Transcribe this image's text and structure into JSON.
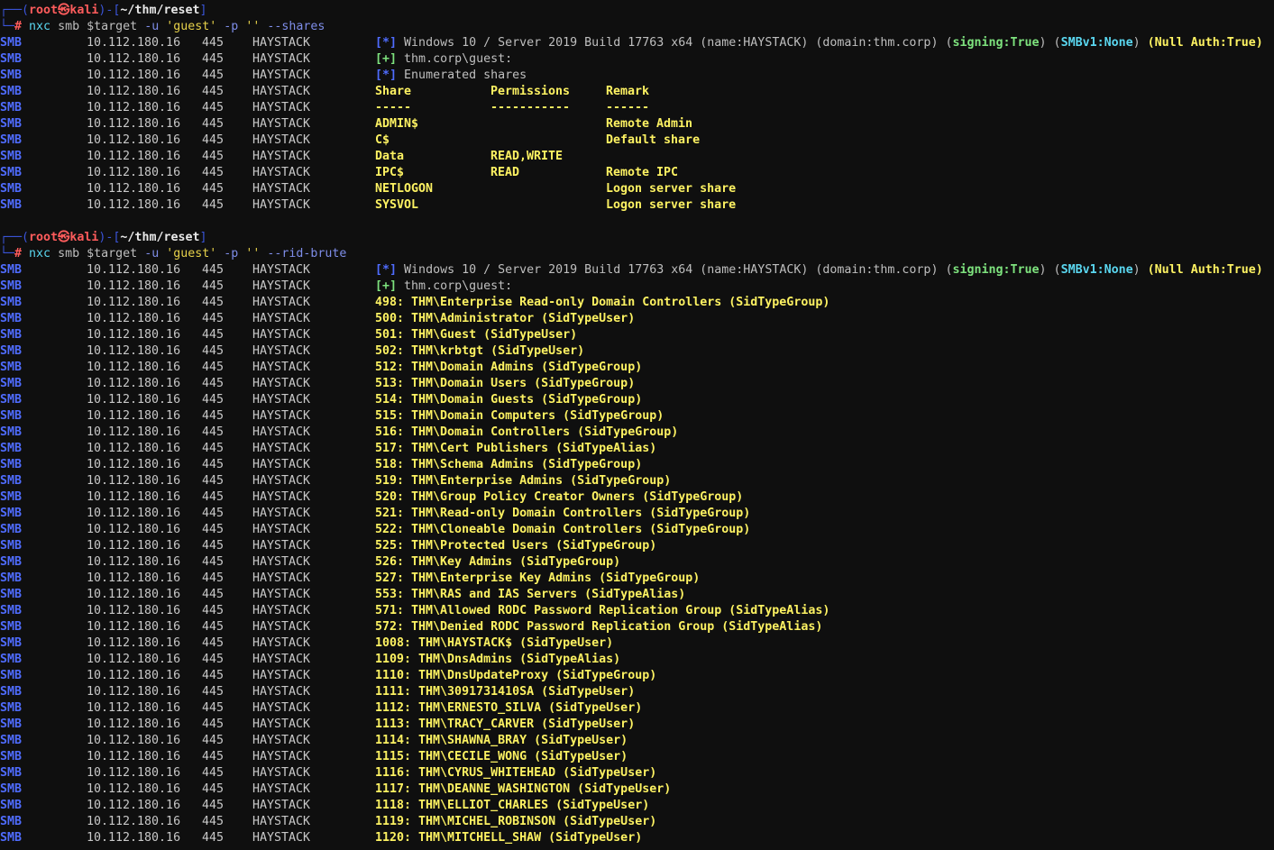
{
  "prompt": {
    "user": "root",
    "skull": "㉿",
    "host": "kali",
    "path": "~/thm/reset",
    "hash": "#"
  },
  "commands": [
    {
      "bin": "nxc",
      "sub": "smb",
      "target": "$target",
      "uflag": "-u",
      "uval": "'guest'",
      "pflag": "-p",
      "pval": "''",
      "opt": "--shares"
    },
    {
      "bin": "nxc",
      "sub": "smb",
      "target": "$target",
      "uflag": "-u",
      "uval": "'guest'",
      "pflag": "-p",
      "pval": "''",
      "opt": "--rid-brute"
    }
  ],
  "row_prefix": {
    "proto": "SMB",
    "ip": "10.112.180.16",
    "port": "445",
    "host": "HAYSTACK"
  },
  "info": {
    "star": "[*]",
    "os": "Windows 10 / Server 2019 Build 17763 x64 (name:HAYSTACK) (domain:thm.corp)",
    "signing": "signing:True",
    "smbv1": "SMBv1:None",
    "null_auth": "Null Auth:True",
    "plus": "[+]",
    "auth_user": "thm.corp\\guest:"
  },
  "shares": {
    "enum_label": "Enumerated shares",
    "headers": [
      "Share",
      "Permissions",
      "Remark"
    ],
    "dashes": [
      "-----",
      "-----------",
      "------"
    ],
    "rows": [
      {
        "share": "ADMIN$",
        "perm": "",
        "remark": "Remote Admin"
      },
      {
        "share": "C$",
        "perm": "",
        "remark": "Default share"
      },
      {
        "share": "Data",
        "perm": "READ,WRITE",
        "remark": ""
      },
      {
        "share": "IPC$",
        "perm": "READ",
        "remark": "Remote IPC"
      },
      {
        "share": "NETLOGON",
        "perm": "",
        "remark": "Logon server share"
      },
      {
        "share": "SYSVOL",
        "perm": "",
        "remark": "Logon server share"
      }
    ]
  },
  "rids": [
    "498: THM\\Enterprise Read-only Domain Controllers (SidTypeGroup)",
    "500: THM\\Administrator (SidTypeUser)",
    "501: THM\\Guest (SidTypeUser)",
    "502: THM\\krbtgt (SidTypeUser)",
    "512: THM\\Domain Admins (SidTypeGroup)",
    "513: THM\\Domain Users (SidTypeGroup)",
    "514: THM\\Domain Guests (SidTypeGroup)",
    "515: THM\\Domain Computers (SidTypeGroup)",
    "516: THM\\Domain Controllers (SidTypeGroup)",
    "517: THM\\Cert Publishers (SidTypeAlias)",
    "518: THM\\Schema Admins (SidTypeGroup)",
    "519: THM\\Enterprise Admins (SidTypeGroup)",
    "520: THM\\Group Policy Creator Owners (SidTypeGroup)",
    "521: THM\\Read-only Domain Controllers (SidTypeGroup)",
    "522: THM\\Cloneable Domain Controllers (SidTypeGroup)",
    "525: THM\\Protected Users (SidTypeGroup)",
    "526: THM\\Key Admins (SidTypeGroup)",
    "527: THM\\Enterprise Key Admins (SidTypeGroup)",
    "553: THM\\RAS and IAS Servers (SidTypeAlias)",
    "571: THM\\Allowed RODC Password Replication Group (SidTypeAlias)",
    "572: THM\\Denied RODC Password Replication Group (SidTypeAlias)",
    "1008: THM\\HAYSTACK$ (SidTypeUser)",
    "1109: THM\\DnsAdmins (SidTypeAlias)",
    "1110: THM\\DnsUpdateProxy (SidTypeGroup)",
    "1111: THM\\3091731410SA (SidTypeUser)",
    "1112: THM\\ERNESTO_SILVA (SidTypeUser)",
    "1113: THM\\TRACY_CARVER (SidTypeUser)",
    "1114: THM\\SHAWNA_BRAY (SidTypeUser)",
    "1115: THM\\CECILE_WONG (SidTypeUser)",
    "1116: THM\\CYRUS_WHITEHEAD (SidTypeUser)",
    "1117: THM\\DEANNE_WASHINGTON (SidTypeUser)",
    "1118: THM\\ELLIOT_CHARLES (SidTypeUser)",
    "1119: THM\\MICHEL_ROBINSON (SidTypeUser)",
    "1120: THM\\MITCHELL_SHAW (SidTypeUser)"
  ]
}
